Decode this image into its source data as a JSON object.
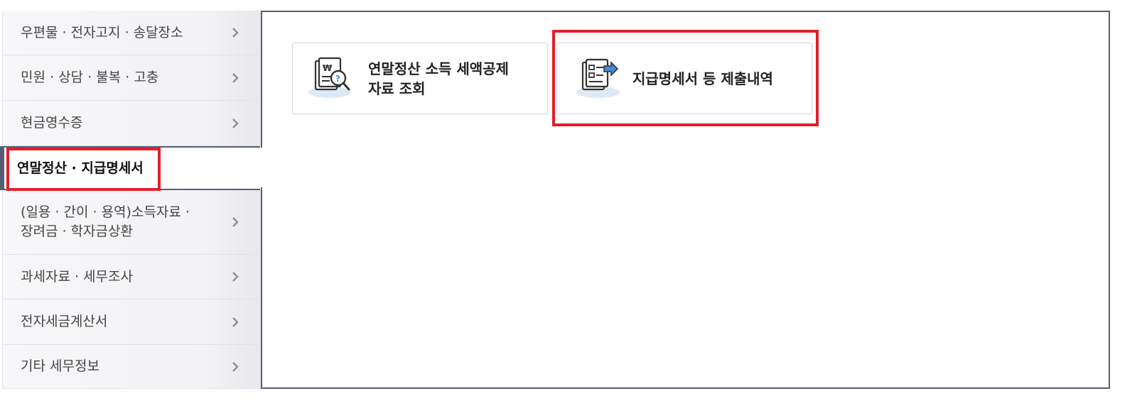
{
  "sidebar": {
    "items": [
      {
        "label": "우편물 · 전자고지 · 송달장소"
      },
      {
        "label": "민원 · 상담 · 불복 · 고충"
      },
      {
        "label": "현금영수증"
      },
      {
        "label": "연말정산 · 지급명세서",
        "active": true
      },
      {
        "label": "(일용 · 간이 · 용역)소득자료 ·\n장려금 · 학자금상환"
      },
      {
        "label": "과세자료 · 세무조사"
      },
      {
        "label": "전자세금계산서"
      },
      {
        "label": "기타 세무정보"
      }
    ]
  },
  "panel": {
    "cards": [
      {
        "label": "연말정산 소득 세액공제\n자료 조회",
        "icon": "document-search-icon"
      },
      {
        "label": "지급명세서 등 제출내역",
        "icon": "document-submit-icon"
      }
    ]
  },
  "colors": {
    "highlight": "#e0202a",
    "panel_border": "#555f72",
    "icon_accent": "#3f8fd8"
  }
}
